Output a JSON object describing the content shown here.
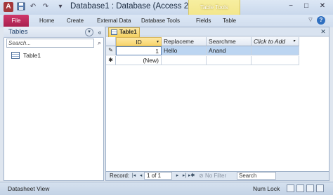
{
  "window": {
    "title": "Database1 : Database (Access 20",
    "context_tab_group": "Table Tools",
    "minimize": "−",
    "maximize": "□",
    "close": "✕"
  },
  "quick_access": {
    "app_icon": "A",
    "save_icon": "💾",
    "undo_icon": "↶",
    "redo_icon": "↷",
    "customize_icon": "▾"
  },
  "ribbon": {
    "file": "File",
    "tabs": [
      "Home",
      "Create",
      "External Data",
      "Database Tools",
      "Fields",
      "Table"
    ],
    "collapse_icon": "▽",
    "help_icon": "?"
  },
  "nav_pane": {
    "title": "Tables",
    "menu_icon": "▾",
    "shutter_icon": "«",
    "search_placeholder": "Search...",
    "search_icon": "⌕",
    "items": [
      {
        "label": "Table1"
      }
    ]
  },
  "document": {
    "tab_label": "Table1",
    "close_icon": "✕",
    "columns": [
      "ID",
      "Replaceme",
      "Searchme",
      "Click to Add"
    ],
    "rows": [
      {
        "selector": "✎",
        "id": "1",
        "replaceme": "Hello",
        "searchme": "Anand"
      },
      {
        "selector": "✱",
        "id": "(New)",
        "replaceme": "",
        "searchme": ""
      }
    ]
  },
  "record_nav": {
    "label": "Record:",
    "first": "|◂",
    "prev": "◂",
    "position": "1 of 1",
    "next": "▸",
    "last": "▸|",
    "new": "▸✱",
    "filter": "No Filter",
    "filter_icon": "⊘",
    "search": "Search"
  },
  "status": {
    "left": "Datasheet View",
    "right": "Num Lock"
  }
}
